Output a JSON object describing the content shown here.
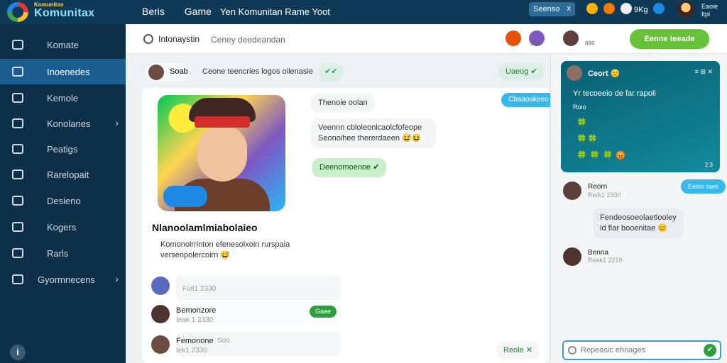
{
  "topbar": {
    "brand_small": "Komunitas",
    "brand": "Komunitax",
    "nav": [
      "Beris",
      "Game"
    ],
    "title": "Yen Komunitan Rame  Yoot",
    "search": "Seenso",
    "search_x": "x",
    "count": "9Kg",
    "user_name": "Eaoie",
    "user_sub": "Itpl"
  },
  "sidebar": {
    "items": [
      {
        "label": "Komate",
        "icon": "home-icon"
      },
      {
        "label": "Inoenedes",
        "icon": "puzzle-icon",
        "active": true
      },
      {
        "label": "Kemole",
        "icon": "compass-icon"
      },
      {
        "label": "Konolanes",
        "icon": "users-icon",
        "chevron": "›"
      },
      {
        "label": "Peatigs",
        "icon": "bag-icon"
      },
      {
        "label": "Rarelopait",
        "icon": "chart-icon"
      },
      {
        "label": "Desieno",
        "icon": "gear-icon"
      },
      {
        "label": "Kogers",
        "icon": "avatar-icon"
      },
      {
        "label": "Rarls",
        "icon": "clock-icon"
      },
      {
        "label": "Gyormnecens",
        "icon": "globe-icon",
        "chevron": "›"
      }
    ],
    "info_glyph": "i"
  },
  "header2": {
    "title": "Intonaystin",
    "subtitle": "Ceney deedeandan",
    "count1": "993",
    "count2": "899",
    "button": "Eenne teeade"
  },
  "chat": {
    "user_pill": "Soab",
    "topic": "Ceone teencries logos oilenasie",
    "toggle_pill": "Uaeog",
    "card_title": "Nlanoolamlmiabolaieo",
    "card_desc": "Komonolrrinton efenesolxoin rurspaia versenpolercoirn 😅",
    "bubble1": "Thenoie oolan",
    "bubble2": "Veennn cbloleonlcaolcfofeope Seonoihee thererdaeen 😅😆",
    "bubble3": "Deenomoenoe ✔",
    "blue_label": "Cbaaoakeeo",
    "row1_text": "Fuit1 2330",
    "row2_name": "Bemonzore",
    "row2_time": "Ieak 1 2330",
    "row2_badge": "Gaae",
    "row3_name": "Femonone",
    "row3_meta": "Soo",
    "row3_time": "Iek1 2330",
    "bottom_pill": "Reole"
  },
  "right": {
    "card_name": "Ceort 😊",
    "card_msg": "Yr tecoeeio de far rapoli",
    "card_meta": "Roio",
    "card_emojis1": "🍀",
    "card_emojis2": "🍀🍀",
    "card_emojis3": "🍀 🍀 🍀 😡",
    "card_time": "2:3",
    "msg1_name": "Reorn",
    "msg1_time": "Rerk1 2330",
    "msg1_pill": "Eeino taeo",
    "msg2_text": "Fendeosoeolaetlooley id flar booenitae 😊",
    "msg3_name": "Benna",
    "msg3_time": "Reek1 2219",
    "input_placeholder": "Repeasic ehnages"
  }
}
